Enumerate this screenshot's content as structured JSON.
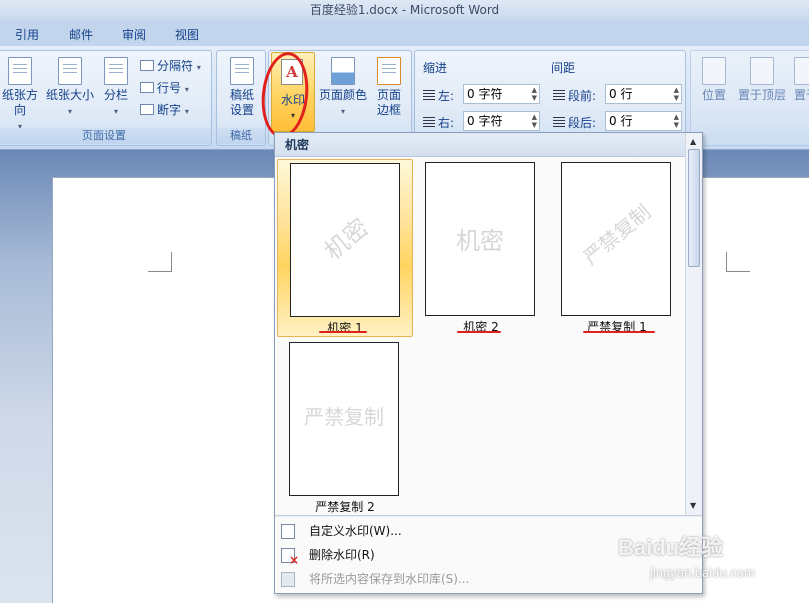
{
  "window": {
    "title": "百度经验1.docx - Microsoft Word"
  },
  "menu_tabs": [
    "引用",
    "邮件",
    "审阅",
    "视图"
  ],
  "ribbon": {
    "page_setup": {
      "group_label": "页面设置",
      "orientation": "纸张方向",
      "size": "纸张大小",
      "columns": "分栏",
      "breaks": "分隔符",
      "line_numbers": "行号",
      "hyphenation": "断字"
    },
    "manuscript": {
      "group_label": "稿纸",
      "setup_line1": "稿纸",
      "setup_line2": "设置"
    },
    "watermark": {
      "label": "水印"
    },
    "page_color": {
      "label": "页面颜色"
    },
    "page_borders": {
      "line1": "页面",
      "line2": "边框"
    },
    "indent": {
      "heading": "缩进",
      "left_label": "左:",
      "left_value": "0 字符",
      "right_label": "右:",
      "right_value": "0 字符"
    },
    "spacing": {
      "heading": "间距",
      "before_label": "段前:",
      "before_value": "0 行",
      "after_label": "段后:",
      "after_value": "0 行"
    },
    "arrange": {
      "position": "位置",
      "bring_front": "置于顶层",
      "send_back": "置于"
    }
  },
  "gallery": {
    "category": "机密",
    "items": [
      {
        "caption": "机密 1",
        "watermark": "机密",
        "selected": true
      },
      {
        "caption": "机密 2",
        "watermark": "机密",
        "selected": false
      },
      {
        "caption": "严禁复制 1",
        "watermark": "严禁复制",
        "selected": false
      },
      {
        "caption": "严禁复制 2",
        "watermark": "严禁复制",
        "selected": false
      }
    ],
    "menu": {
      "custom": "自定义水印(W)...",
      "remove": "删除水印(R)",
      "save": "将所选内容保存到水印库(S)..."
    }
  },
  "watermark_logo": {
    "brand": "Baidu经验",
    "sub": "jingyan.baidu.com"
  },
  "colors": {
    "ribbon_text": "#15428b",
    "highlight": "#ffd35f",
    "annotation": "#e0201c"
  }
}
